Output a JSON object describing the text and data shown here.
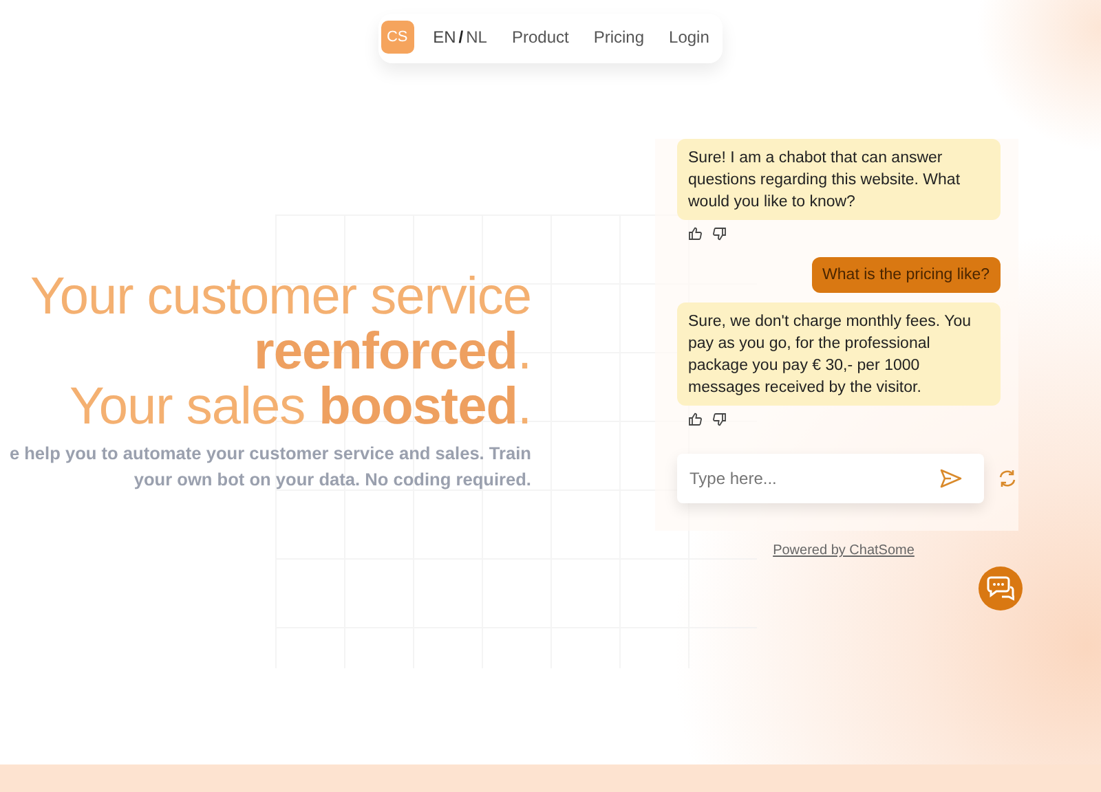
{
  "nav": {
    "logo": "CS",
    "languages": [
      {
        "label": "EN",
        "selected": true
      },
      {
        "label": "NL",
        "selected": false
      }
    ],
    "separator": "/",
    "links": [
      "Product",
      "Pricing",
      "Login"
    ]
  },
  "hero": {
    "headline": [
      "Your customer service",
      "**reenforced**.",
      "Your sales **boosted**."
    ],
    "subtitle": [
      "e help you to automate your customer service and sales. Train",
      "your own bot on your data. No coding required."
    ]
  },
  "chat": {
    "messages": [
      {
        "kind": "bot",
        "text": "Sure! I am a chabot that can answer questions regarding this website. What would you like to know?"
      },
      {
        "kind": "user",
        "text": "What is the pricing like?"
      },
      {
        "kind": "bot",
        "text": "Sure, we don't charge monthly fees. You pay as you go, for the professional package you pay € 30,- per 1000 messages received by the visitor."
      }
    ],
    "input": {
      "placeholder": "Type here..."
    },
    "powered_by": "Powered by ChatSome"
  }
}
